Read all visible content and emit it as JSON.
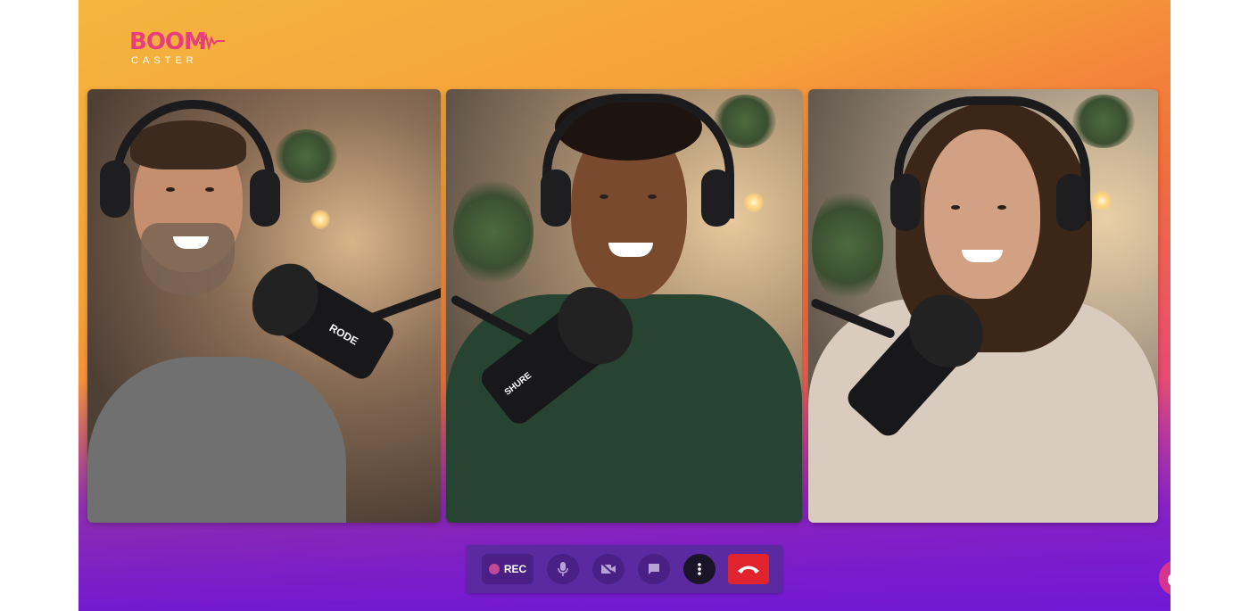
{
  "brand": {
    "logo_word": "BOOM",
    "logo_sub": "CASTER",
    "colors": {
      "logo_pink": "#e83e7e",
      "bg_top": "#f4b53e",
      "bg_bottom": "#6c16d6",
      "hangup_red": "#e0232c"
    }
  },
  "participants": [
    {
      "mic_brand": "RODE",
      "shirt": "grey t-shirt"
    },
    {
      "mic_brand": "SHURE",
      "shirt": "green sweater"
    },
    {
      "mic_brand": "",
      "shirt": "cream sweater"
    }
  ],
  "controls": {
    "record_label": "REC",
    "buttons": [
      {
        "icon": "mic-icon",
        "state": "muted"
      },
      {
        "icon": "camera-off-icon",
        "state": "off"
      },
      {
        "icon": "chat-icon"
      },
      {
        "icon": "more-vertical-icon"
      },
      {
        "icon": "hangup-icon"
      }
    ]
  },
  "help": {
    "icon": "chat-bubble-icon"
  }
}
